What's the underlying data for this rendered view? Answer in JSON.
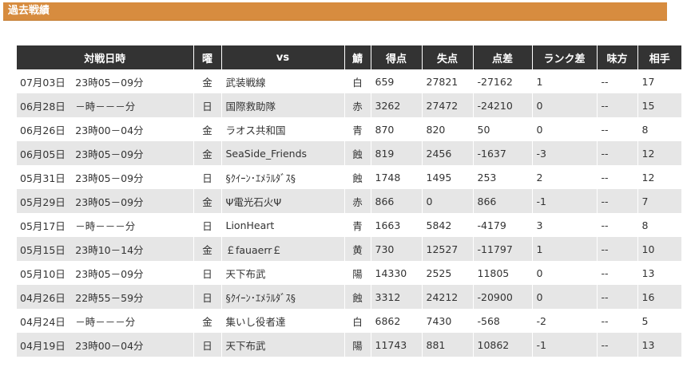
{
  "section": {
    "title": "過去戦績"
  },
  "table": {
    "headers": [
      "対戦日時",
      "曜",
      "vs",
      "鯖",
      "得点",
      "失点",
      "点差",
      "ランク差",
      "味方",
      "相手"
    ],
    "rows": [
      [
        "07月03日　23時05－09分",
        "金",
        "武装戦線",
        "白",
        "659",
        "27821",
        "-27162",
        "1",
        "--",
        "17"
      ],
      [
        "06月28日　－時－－－分",
        "日",
        "国際救助隊",
        "赤",
        "3262",
        "27472",
        "-24210",
        "0",
        "--",
        "15"
      ],
      [
        "06月26日　23時00－04分",
        "金",
        "ラオス共和国",
        "青",
        "870",
        "820",
        "50",
        "0",
        "--",
        "8"
      ],
      [
        "06月05日　23時05－09分",
        "金",
        "SeaSide_Friends",
        "蝕",
        "819",
        "2456",
        "-1637",
        "-3",
        "--",
        "12"
      ],
      [
        "05月31日　23時05－09分",
        "日",
        "§ｸｲｰﾝ･ｴﾒﾗﾙﾀﾞｽ§",
        "蝕",
        "1748",
        "1495",
        "253",
        "2",
        "--",
        "12"
      ],
      [
        "05月29日　23時05－09分",
        "金",
        "Ψ電光石火Ψ",
        "赤",
        "866",
        "0",
        "866",
        "-1",
        "--",
        "7"
      ],
      [
        "05月17日　－時－－－分",
        "日",
        "LionHeart",
        "青",
        "1663",
        "5842",
        "-4179",
        "3",
        "--",
        "8"
      ],
      [
        "05月15日　23時10－14分",
        "金",
        "￡fauaerr￡",
        "黄",
        "730",
        "12527",
        "-11797",
        "1",
        "--",
        "10"
      ],
      [
        "05月10日　23時05－09分",
        "日",
        "天下布武",
        "陽",
        "14330",
        "2525",
        "11805",
        "0",
        "--",
        "13"
      ],
      [
        "04月26日　22時55－59分",
        "日",
        "§ｸｲｰﾝ･ｴﾒﾗﾙﾀﾞｽ§",
        "蝕",
        "3312",
        "24212",
        "-20900",
        "0",
        "--",
        "16"
      ],
      [
        "04月24日　－時－－－分",
        "金",
        "集いし役者達",
        "白",
        "6862",
        "7430",
        "-568",
        "-2",
        "--",
        "5"
      ],
      [
        "04月19日　23時00－04分",
        "日",
        "天下布武",
        "陽",
        "11743",
        "881",
        "10862",
        "-1",
        "--",
        "13"
      ]
    ]
  }
}
